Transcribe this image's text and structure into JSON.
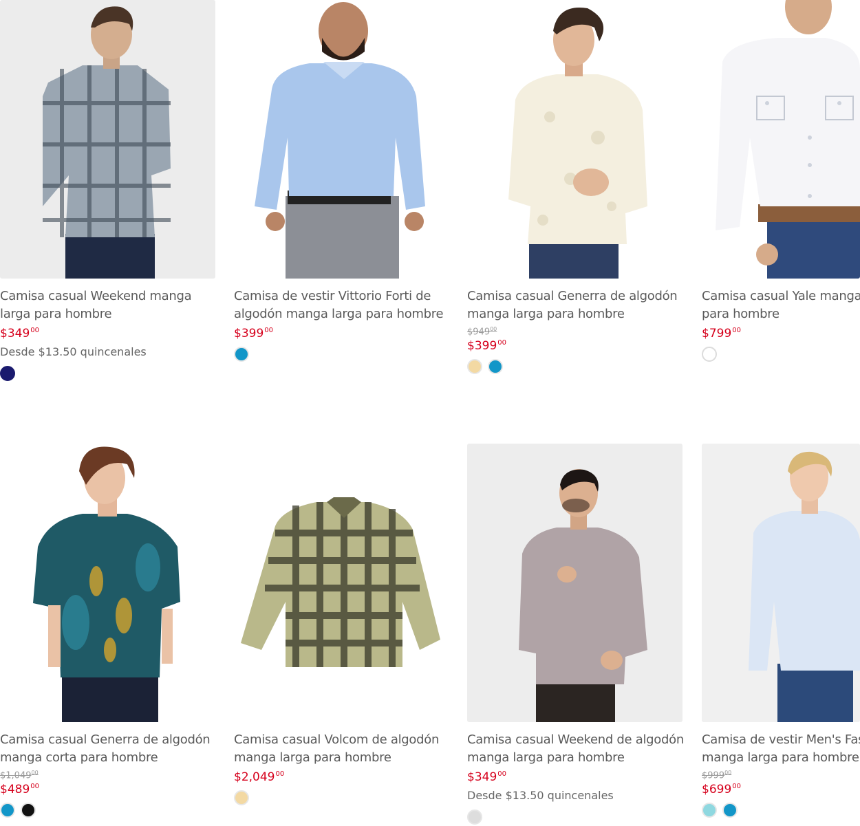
{
  "products": [
    {
      "title_l1": "Camisa casual Weekend manga",
      "title_l2": "larga para hombre",
      "old_price": "",
      "price": "$349",
      "price_cents": "00",
      "installments": "Desde $13.50 quincenales",
      "swatches": [
        "#1a1a6e"
      ]
    },
    {
      "title_l1": "Camisa de vestir Vittorio Forti de",
      "title_l2": "algodón manga larga para hombre",
      "old_price": "",
      "price": "$399",
      "price_cents": "00",
      "installments": "",
      "swatches": [
        "#1296c8"
      ]
    },
    {
      "title_l1": "Camisa casual Generra de algodón",
      "title_l2": "manga larga para hombre",
      "old_price": "$949",
      "old_cents": "00",
      "price": "$399",
      "price_cents": "00",
      "installments": "",
      "swatches": [
        "#f3d9a3",
        "#1296c8"
      ]
    },
    {
      "title_l1": "Camisa casual Yale manga",
      "title_l2": "para hombre",
      "old_price": "",
      "price": "$799",
      "price_cents": "00",
      "installments": "",
      "swatches": [
        "#ffffff"
      ]
    },
    {
      "title_l1": "Camisa casual Generra de algodón",
      "title_l2": "manga corta para hombre",
      "old_price": "$1,049",
      "old_cents": "00",
      "price": "$489",
      "price_cents": "00",
      "installments": "",
      "swatches": [
        "#1296c8",
        "#111111"
      ]
    },
    {
      "title_l1": "Camisa casual Volcom de algodón",
      "title_l2": "manga larga para hombre",
      "old_price": "",
      "price": "$2,049",
      "price_cents": "00",
      "installments": "",
      "swatches": [
        "#f3d9a3"
      ]
    },
    {
      "title_l1": "Camisa casual Weekend de algodón",
      "title_l2": "manga larga para hombre",
      "old_price": "",
      "price": "$349",
      "price_cents": "00",
      "installments": "Desde $13.50 quincenales",
      "swatches": [
        "#dddddd"
      ]
    },
    {
      "title_l1": "Camisa de vestir Men's Fas",
      "title_l2": "manga larga para hombre",
      "old_price": "$999",
      "old_cents": "00",
      "price": "$699",
      "price_cents": "00",
      "installments": "",
      "swatches": [
        "#8fd8e0",
        "#1296c8"
      ]
    }
  ]
}
